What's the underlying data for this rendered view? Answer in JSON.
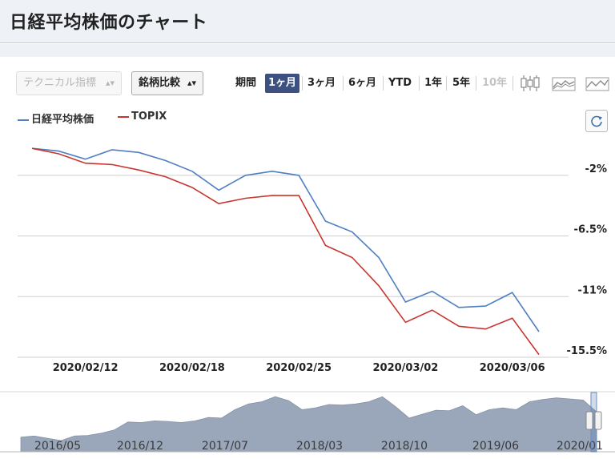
{
  "page": {
    "title": "日経平均株価のチャート"
  },
  "toolbar": {
    "technical_select": "テクニカル指標",
    "compare_select": "銘柄比較",
    "period_label": "期間",
    "periods": [
      {
        "label": "1ヶ月",
        "state": "active"
      },
      {
        "label": "3ヶ月",
        "state": "normal"
      },
      {
        "label": "6ヶ月",
        "state": "normal"
      },
      {
        "label": "YTD",
        "state": "normal"
      },
      {
        "label": "1年",
        "state": "normal"
      },
      {
        "label": "5年",
        "state": "normal"
      },
      {
        "label": "10年",
        "state": "disabled"
      }
    ],
    "chart_type_icons": [
      "candlestick-icon",
      "area-chart-icon",
      "line-chart-icon"
    ],
    "refresh_icon": "refresh-icon"
  },
  "colors": {
    "nikkei": "#4f7ec2",
    "topix": "#c8352f",
    "active_period": "#3d5180",
    "navigator_fill": "#9aa7ba"
  },
  "chart_data": [
    {
      "type": "line",
      "x": [
        "2020/02/07",
        "2020/02/10",
        "2020/02/12",
        "2020/02/13",
        "2020/02/14",
        "2020/02/17",
        "2020/02/18",
        "2020/02/19",
        "2020/02/20",
        "2020/02/21",
        "2020/02/25",
        "2020/02/26",
        "2020/02/27",
        "2020/02/28",
        "2020/03/02",
        "2020/03/03",
        "2020/03/04",
        "2020/03/05",
        "2020/03/06",
        "2020/03/09"
      ],
      "x_tick_labels": [
        "2020/02/12",
        "2020/02/18",
        "2020/02/25",
        "2020/03/02",
        "2020/03/06"
      ],
      "series": [
        {
          "name": "日経平均株価",
          "values": [
            0,
            -0.2,
            -0.8,
            -0.1,
            -0.3,
            -0.9,
            -1.7,
            -3.1,
            -2.0,
            -1.7,
            -2.0,
            -5.4,
            -6.2,
            -8.1,
            -11.4,
            -10.6,
            -11.8,
            -11.7,
            -10.7,
            -13.6
          ]
        },
        {
          "name": "TOPIX",
          "values": [
            0,
            -0.4,
            -1.1,
            -1.2,
            -1.6,
            -2.1,
            -2.9,
            -4.1,
            -3.7,
            -3.5,
            -3.5,
            -7.2,
            -8.1,
            -10.2,
            -12.9,
            -12.0,
            -13.2,
            -13.4,
            -12.6,
            -15.3
          ]
        }
      ],
      "y_ticks": [
        -2,
        -6.5,
        -11,
        -15.5
      ],
      "y_tick_labels": [
        "-2%",
        "-6.5%",
        "-11%",
        "-15.5%"
      ],
      "ylim": [
        -15.5,
        1.5
      ],
      "grid": true,
      "legend": "top-left"
    },
    {
      "type": "area",
      "x_tick_labels": [
        "2016/05",
        "2016/12",
        "2017/07",
        "2018/03",
        "2018/10",
        "2019/06",
        "2020/01"
      ],
      "values": [
        16.6,
        16.8,
        16.4,
        16.0,
        16.8,
        16.9,
        17.3,
        17.9,
        19.3,
        19.2,
        19.5,
        19.4,
        19.2,
        19.5,
        20.1,
        20.0,
        21.5,
        22.5,
        22.9,
        23.8,
        23.1,
        21.5,
        21.8,
        22.4,
        22.3,
        22.5,
        22.9,
        23.8,
        22.0,
        20.0,
        20.7,
        21.4,
        21.3,
        22.2,
        20.6,
        21.5,
        21.8,
        21.5,
        22.9,
        23.3,
        23.6,
        23.4,
        23.2,
        21.1
      ]
    }
  ]
}
